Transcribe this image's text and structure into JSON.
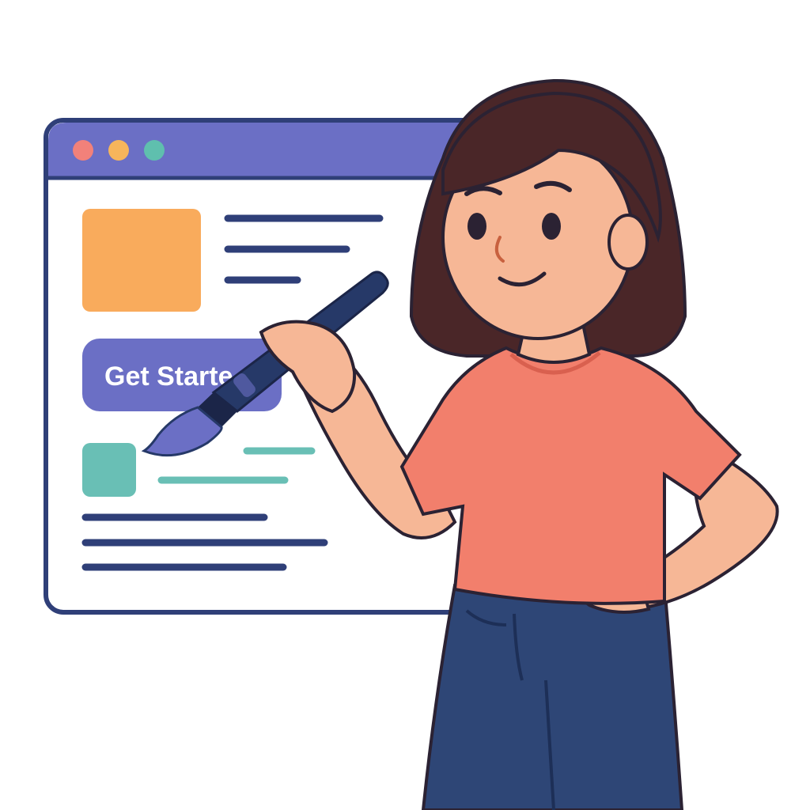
{
  "illustration": {
    "window": {
      "frame_color": "#2f3f78",
      "titlebar_color": "#6b6fc5",
      "window_dots": [
        {
          "icon": "close-dot-icon",
          "color": "#f2817a"
        },
        {
          "icon": "minimize-dot-icon",
          "color": "#f6b55b"
        },
        {
          "icon": "maximize-dot-icon",
          "color": "#5fbfae"
        }
      ],
      "content": {
        "image_block_color": "#f9ab5c",
        "cta_button": {
          "label": "Get Starte",
          "color": "#6b6fc5",
          "text_color": "#ffffff"
        },
        "thumb_block_color": "#69bfb5",
        "accent_line_color": "#69bfb5",
        "text_line_color": "#2f3f78"
      }
    },
    "person": {
      "hair_color": "#4a2628",
      "skin_color": "#f6b796",
      "shirt_color": "#f27f6c",
      "jeans_color": "#2e4676",
      "outline_color": "#2b2233"
    },
    "paintbrush": {
      "icon": "paintbrush-icon",
      "handle_color": "#263968",
      "bristle_color": "#6b6fc5"
    }
  }
}
